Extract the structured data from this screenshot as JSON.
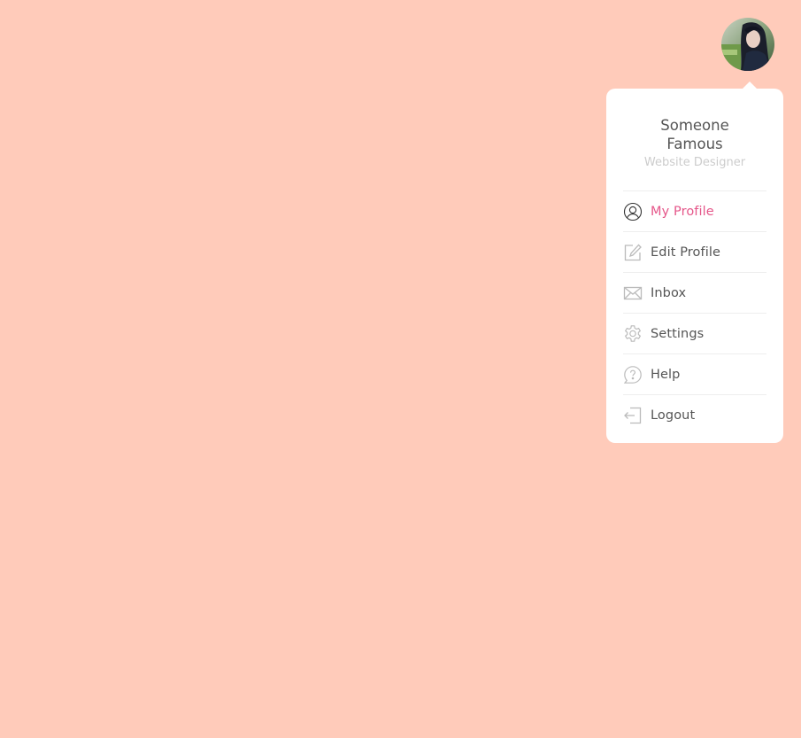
{
  "avatar": {
    "alt": "Profile photo",
    "icon": "user-photo"
  },
  "profile": {
    "name": "Someone Famous",
    "role": "Website Designer"
  },
  "menu": {
    "items": [
      {
        "label": "My Profile",
        "icon": "user-circle-icon",
        "active": true
      },
      {
        "label": "Edit Profile",
        "icon": "edit-icon",
        "active": false
      },
      {
        "label": "Inbox",
        "icon": "envelope-icon",
        "active": false
      },
      {
        "label": "Settings",
        "icon": "gear-icon",
        "active": false
      },
      {
        "label": "Help",
        "icon": "question-bubble-icon",
        "active": false
      },
      {
        "label": "Logout",
        "icon": "logout-icon",
        "active": false
      }
    ]
  },
  "colors": {
    "background": "#ffcbba",
    "accent": "#e5578a",
    "text": "#555555",
    "muted": "#cccccc",
    "icon": "#bbbbbb"
  }
}
